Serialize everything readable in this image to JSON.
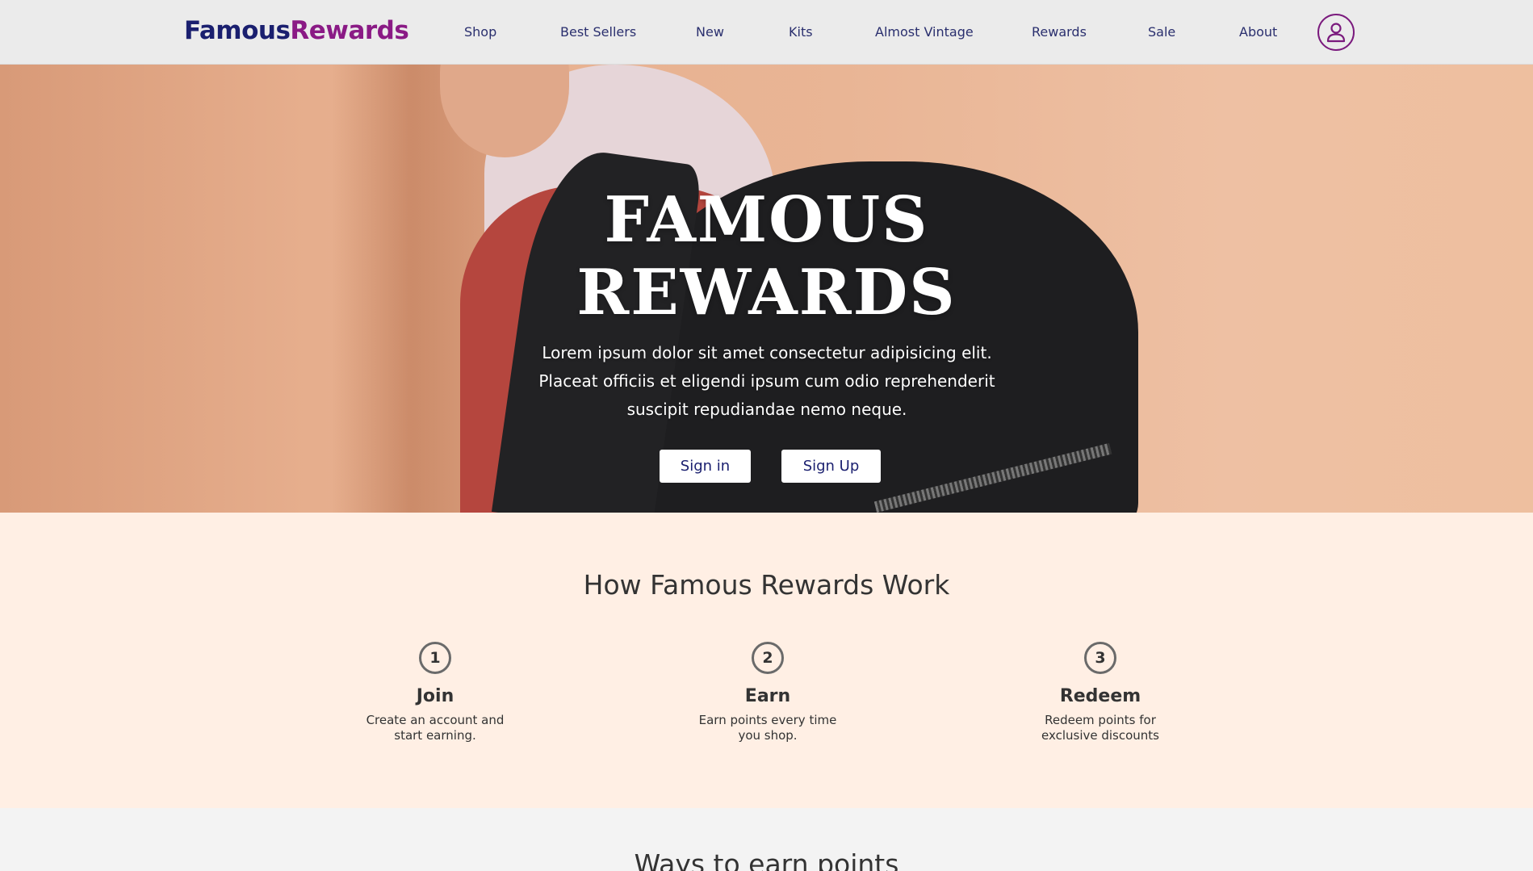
{
  "brand": {
    "part1": "Famous",
    "part2": "Rewards",
    "color1": "#1a1f6f",
    "color2": "#8a1a85"
  },
  "nav": {
    "items": [
      "Shop",
      "Best Sellers",
      "New",
      "Kits",
      "Almost Vintage",
      "Rewards",
      "Sale",
      "About"
    ],
    "account_icon": "user-circle-icon"
  },
  "hero": {
    "title_line1": "FAMOUS",
    "title_line2": "REWARDS",
    "text": "Lorem ipsum dolor sit amet consectetur adipisicing elit. Placeat officiis et eligendi ipsum cum odio reprehenderit suscipit repudiandae nemo neque.",
    "signin_label": "Sign in",
    "signup_label": "Sign Up"
  },
  "how": {
    "title": "How Famous Rewards Work",
    "steps": [
      {
        "num": "1",
        "title": "Join",
        "desc": "Create an account and start earning."
      },
      {
        "num": "2",
        "title": "Earn",
        "desc": "Earn points every time you shop."
      },
      {
        "num": "3",
        "title": "Redeem",
        "desc": "Redeem points for exclusive discounts"
      }
    ]
  },
  "ways": {
    "title": "Ways to earn points"
  }
}
